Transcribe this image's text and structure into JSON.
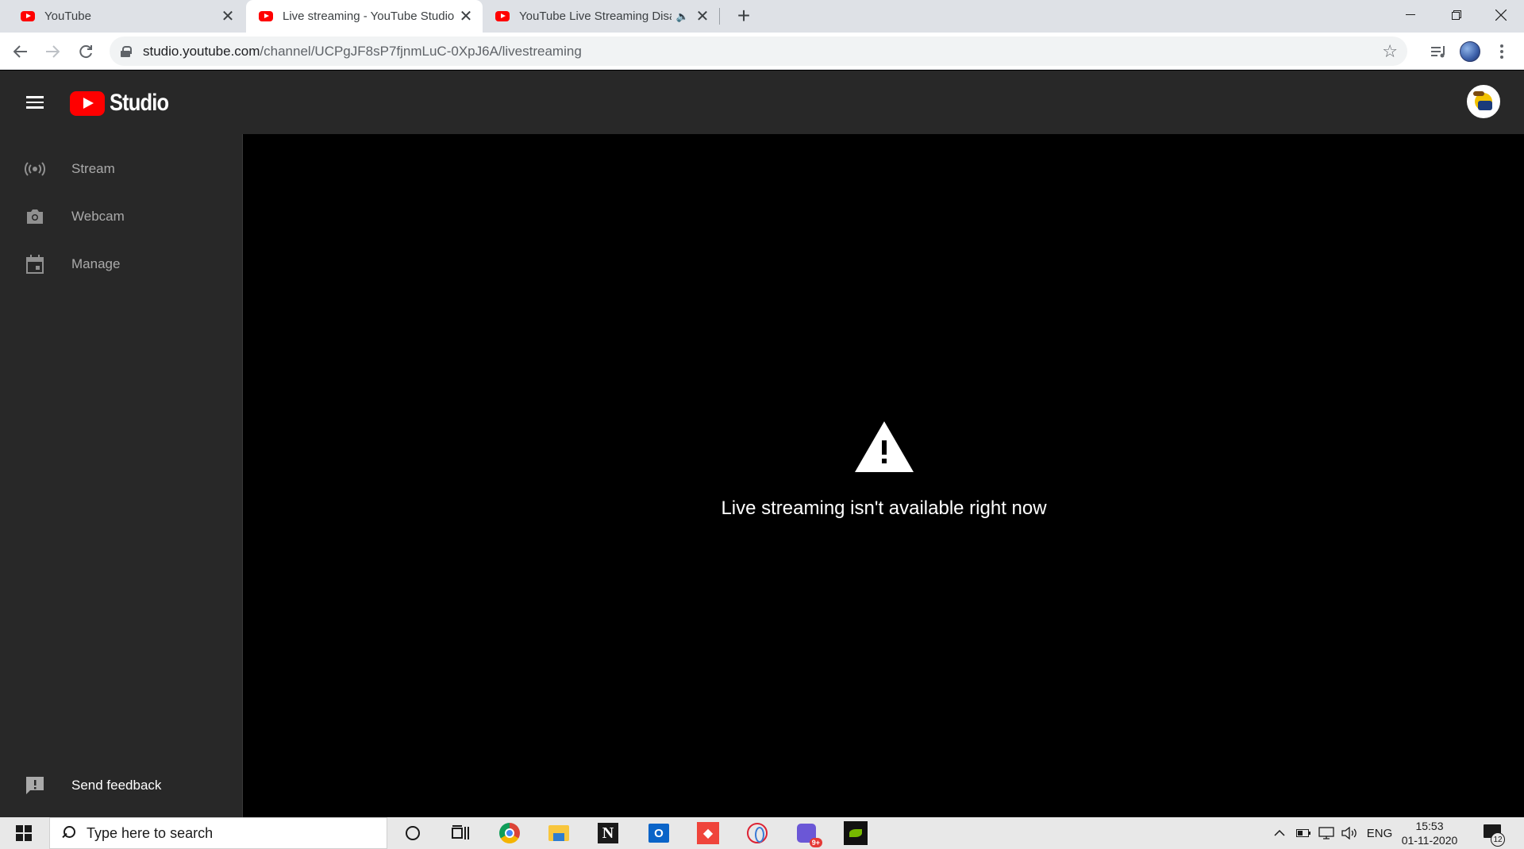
{
  "browser": {
    "tabs": [
      {
        "title": "YouTube",
        "active": false
      },
      {
        "title": "Live streaming - YouTube Studio",
        "active": true
      },
      {
        "title": "YouTube Live Streaming Disa",
        "active": false,
        "audio": true
      }
    ],
    "url_host": "studio.youtube.com",
    "url_path": "/channel/UCPgJF8sP7fjnmLuC-0XpJ6A/livestreaming"
  },
  "studio": {
    "logo_text": "Studio",
    "sidebar": {
      "items": [
        {
          "label": "Stream",
          "icon": "broadcast-icon"
        },
        {
          "label": "Webcam",
          "icon": "camera-icon"
        },
        {
          "label": "Manage",
          "icon": "calendar-icon"
        }
      ],
      "feedback_label": "Send feedback"
    },
    "main": {
      "message": "Live streaming isn't available right now"
    }
  },
  "taskbar": {
    "search_placeholder": "Type here to search",
    "language": "ENG",
    "time": "15:53",
    "date": "01-11-2020",
    "notification_count": "12",
    "gm_badge": "9+"
  }
}
